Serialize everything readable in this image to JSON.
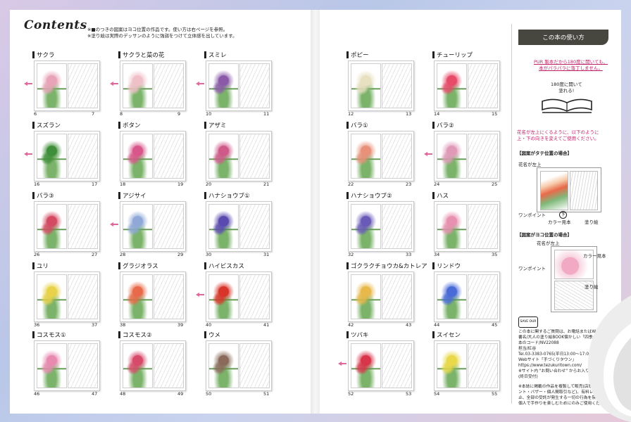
{
  "contents_title": "Contents",
  "notes": [
    "※■のつきの図案はヨコ位置の作品です。使い方は右ページを参照。",
    "※塗り絵は実際のデッサンのように強弱をつけて立体感を出しています。"
  ],
  "entries": [
    {
      "label": "サクラ",
      "left_page": "6",
      "right_page": "7",
      "color": "#e8a3b8",
      "landscape": true
    },
    {
      "label": "サクラと菜の花",
      "left_page": "8",
      "right_page": "9",
      "color": "#f0c0c8",
      "landscape": true
    },
    {
      "label": "スミレ",
      "left_page": "10",
      "right_page": "11",
      "color": "#8a5aa8",
      "landscape": true
    },
    {
      "label": "スズラン",
      "left_page": "16",
      "right_page": "17",
      "color": "#3f8f3a",
      "landscape": true
    },
    {
      "label": "ボタン",
      "left_page": "18",
      "right_page": "19",
      "color": "#d8568a",
      "landscape": false
    },
    {
      "label": "アザミ",
      "left_page": "20",
      "right_page": "21",
      "color": "#cf5a8a",
      "landscape": false
    },
    {
      "label": "バラ③",
      "left_page": "26",
      "right_page": "27",
      "color": "#d44a62",
      "landscape": false
    },
    {
      "label": "アジサイ",
      "left_page": "28",
      "right_page": "29",
      "color": "#8fa8d8",
      "landscape": true
    },
    {
      "label": "ハナショウブ①",
      "left_page": "30",
      "right_page": "31",
      "color": "#5a4ab0",
      "landscape": false
    },
    {
      "label": "ユリ",
      "left_page": "36",
      "right_page": "37",
      "color": "#e8d24a",
      "landscape": false
    },
    {
      "label": "グラジオラス",
      "left_page": "38",
      "right_page": "39",
      "color": "#e86a4a",
      "landscape": false
    },
    {
      "label": "ハイビスカス",
      "left_page": "40",
      "right_page": "41",
      "color": "#d8342a",
      "landscape": true
    },
    {
      "label": "コスモス①",
      "left_page": "46",
      "right_page": "47",
      "color": "#e88ab0",
      "landscape": false
    },
    {
      "label": "コスモス②",
      "left_page": "48",
      "right_page": "49",
      "color": "#d84a6a",
      "landscape": false
    },
    {
      "label": "ウメ",
      "left_page": "50",
      "right_page": "51",
      "color": "#8a6a5a",
      "landscape": false
    },
    {
      "label": "ポピー",
      "left_page": "12",
      "right_page": "13",
      "color": "#e8e0c0",
      "landscape": false
    },
    {
      "label": "チューリップ",
      "left_page": "14",
      "right_page": "15",
      "color": "#e84a6a",
      "landscape": false
    },
    {
      "label": "バラ①",
      "left_page": "22",
      "right_page": "23",
      "color": "#e8907a",
      "landscape": false
    },
    {
      "label": "バラ②",
      "left_page": "24",
      "right_page": "25",
      "color": "#e09ab8",
      "landscape": true
    },
    {
      "label": "ハナショウブ②",
      "left_page": "32",
      "right_page": "33",
      "color": "#6a5ab8",
      "landscape": false
    },
    {
      "label": "ハス",
      "left_page": "34",
      "right_page": "35",
      "color": "#e890b0",
      "landscape": false
    },
    {
      "label": "ゴクラクチョウカ&カトレア",
      "left_page": "42",
      "right_page": "43",
      "color": "#e8b84a",
      "landscape": false
    },
    {
      "label": "リンドウ",
      "left_page": "44",
      "right_page": "45",
      "color": "#4a6ad8",
      "landscape": false
    },
    {
      "label": "ツバキ",
      "left_page": "52",
      "right_page": "53",
      "color": "#d8344a",
      "landscape": true
    },
    {
      "label": "スイセン",
      "left_page": "54",
      "right_page": "55",
      "color": "#e8d84a",
      "landscape": false
    }
  ],
  "sidebar": {
    "title": "この本の使い方",
    "pur_lines": [
      "PUR 製本だから180度に開いても、",
      "本がパラパラに落丁しません。"
    ],
    "open_lines": [
      "180度に開いて",
      "塗れる!"
    ],
    "usage_lines": [
      "花名が左上にくるように、以下のように",
      "上・下の向きを変えてご使用ください。"
    ],
    "tate_heading": "【図案がタテ位置の場合】",
    "yoko_heading": "【図案がヨコ位置の場合】",
    "label_flower_name": "花名が左上",
    "label_onepoint": "ワンポイント",
    "label_color_sample": "カラー見本",
    "label_coloring": "塗り絵",
    "tate_onepoint_mark": "下",
    "contact": [
      "この本に関するご質問は、お電話またはWebで",
      "書名/大人の塗り絵BOOK懐かしい「四季の草花」",
      "本のコード/NV22088",
      "担当/紅谷",
      "Tel.03-3383-0765(平日13:00〜17:00受付)",
      "Webサイト「手づくりタウン」",
      "https://www.tezukuritown.com/",
      "※サイト内 \"お問い合わせ\" からお入りください",
      "(終日受付)"
    ],
    "notice": [
      "※本誌に掲載の作品を複製して販売(店頭・Web・イベ",
      "ント・バザー・個人間取引など)、有料レッスンでの使用を禁",
      "止、全部の受託が発生する一切の行為を禁止しています。",
      "個人で手作りを楽しむためにのみご使用ください。"
    ],
    "logo_text": "SAVE OUR"
  },
  "colors": {
    "accent": "#c0226a",
    "arrow": "#e0679a",
    "header_bg": "#47473f"
  }
}
